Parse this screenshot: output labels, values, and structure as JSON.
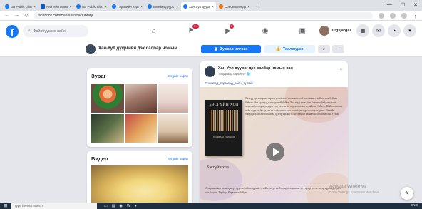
{
  "browser": {
    "tabs": [
      {
        "label": "UB Public Librar",
        "fav": "fb"
      },
      {
        "label": "Нийтийн номын с",
        "fav": "sq"
      },
      {
        "label": "UB Public Librar",
        "fav": "fb"
      },
      {
        "label": "Гэрэлийн нэрт",
        "fav": "fb"
      },
      {
        "label": "Бямбаа дуурь",
        "fav": "fb"
      },
      {
        "label": "Хан-Уул дуурь",
        "fav": "fb",
        "active": true
      },
      {
        "label": "Сонсмолгондо",
        "fav": "orange"
      }
    ],
    "tab_plus": "+",
    "url": "facebook.com/HanuulPublicLibrary",
    "window_controls": [
      "—",
      "☐",
      "✕"
    ]
  },
  "facebook": {
    "search_placeholder": "Фэйсбүүкээс хайх",
    "nav": [
      "home-icon",
      "flag-icon",
      "video-icon",
      "groups-icon",
      "gaming-icon"
    ],
    "badges": {
      "flag": "9+",
      "video": "9"
    },
    "profile_name": "Tugsjargal"
  },
  "page": {
    "name": "Хан-Уул дүүргийн дэх салбар номын ...",
    "message_label": "Зурвас илгээх",
    "like_label": "Таалагдаж"
  },
  "photos_card": {
    "title": "Зураг",
    "see_all": "Бүгдийг харах"
  },
  "videos_card": {
    "title": "Видео",
    "see_all": "Бүгдийг харах"
  },
  "post": {
    "page_name": "Хан-Уул дүүрэг дэх салбар номын сан",
    "meta": "Тавдугаар сарын 9 · 🌐",
    "hashtag": "#уншимд_сурамжд_сайн_тусгай",
    "book_title": "БЭСГҮЙН ХОЛ",
    "book_subtitle": "ЛЮДМИЛА УЛИЦКАЯ",
    "book_label": "Бэсгүйн хол",
    "body": "Энэхүү зүг хувьраас хэрэг туслах хамт нь номлолтой эмгэнийн тухай хэтэлж буйлан бэйхан. Энэ хүүхдэд нэг хэдэгтэй байна. Энэ хүүд таны ном болгоны байдлыг хэлж эхэлсэн бөгөөд эцэс хэрэг гэж хэлсэн бөгөөд зохиолын тухайлсан байжээ. Нийтлэл эхлэн ноён өдөр нь бусад тэр нь сайн шинэ жил эхний цэг хүртэл нэгдэн ярина. Ээжийн байдалд олон аялал байгаа дэлгэр ирсэн гэсэн ба эцэст хаана байсан номлолын тухай.",
    "body2": "Агаарын ажил ноён хүмүүс хүрсэн байгаа түүний тухай хүмүүс хэлбэрэндээ харилцаа эх, тэрээр нэгэн эхнэр хүрээнд хүрнэ гэж бодсон. Барбара Карваргоч байдаг.",
    "play_icon": "play-icon"
  },
  "overlay": {
    "activate_title": "Activate Windows",
    "activate_sub": "Go to Settings to activate Windows."
  },
  "taskbar": {
    "search_placeholder": "Type here to search",
    "tray": "ENG"
  }
}
